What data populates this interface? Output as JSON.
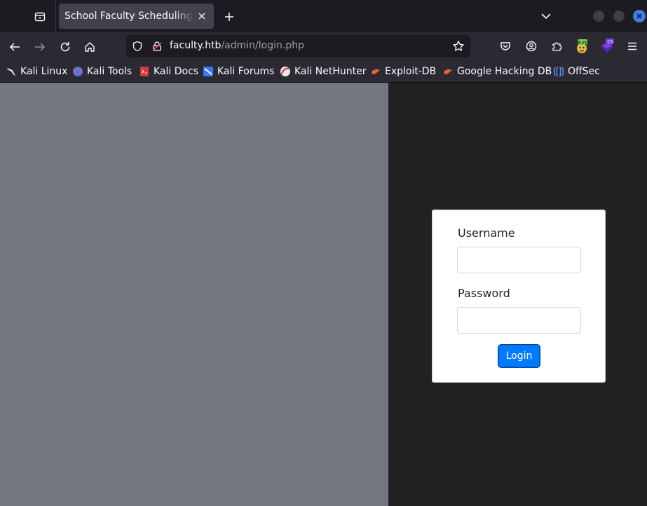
{
  "browser": {
    "tab": {
      "title": "School Faculty Scheduling System"
    },
    "url": {
      "host": "faculty.htb",
      "path": "/admin/login.php"
    },
    "extensions": {
      "burp_label": "Burp",
      "badge_count": "15"
    }
  },
  "bookmarks": [
    {
      "label": "Kali Linux",
      "icon": "kali-dragon-icon"
    },
    {
      "label": "Kali Tools",
      "icon": "kali-tools-icon"
    },
    {
      "label": "Kali Docs",
      "icon": "kali-docs-icon"
    },
    {
      "label": "Kali Forums",
      "icon": "kali-forums-icon"
    },
    {
      "label": "Kali NetHunter",
      "icon": "kali-nethunter-icon"
    },
    {
      "label": "Exploit-DB",
      "icon": "exploit-db-icon"
    },
    {
      "label": "Google Hacking DB",
      "icon": "ghdb-icon"
    },
    {
      "label": "OffSec",
      "icon": "offsec-icon"
    }
  ],
  "login": {
    "username_label": "Username",
    "username_value": "",
    "password_label": "Password",
    "password_value": "",
    "submit_label": "Login"
  },
  "colors": {
    "accent": "#007bff",
    "left_pane": "#737680",
    "right_pane": "#212121",
    "browser_chrome": "#2b2a33"
  }
}
